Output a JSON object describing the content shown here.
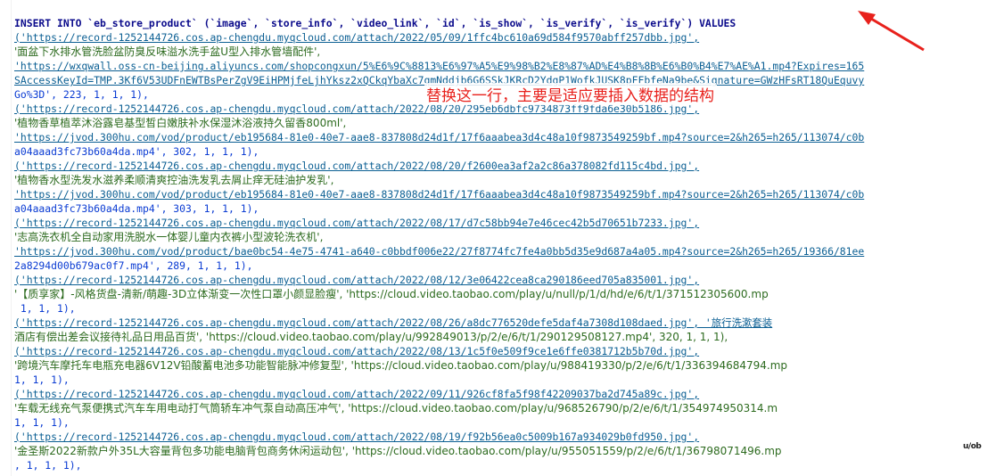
{
  "editor": {
    "lines": [
      {
        "text": "INSERT INTO `eb_store_product` (`image`, `store_info`, `video_link`, `id`, `is_show`, `is_verify`, `is_verify`) VALUES",
        "kind": "kw"
      },
      {
        "text": "('https://record-1252144726.cos.ap-chengdu.myqcloud.com/attach/2022/05/09/1ffc4bc610a69d584f9570abff257dbb.jpg',",
        "kind": "url"
      },
      {
        "text": "'面盆下水排水管洗脸盆防臭反味溢水洗手盆U型入排水管墙配件',",
        "kind": "zh"
      },
      {
        "text": "'https://wxqwall.oss-cn-beijing.aliyuncs.com/shopcongxun/5%E6%9C%8813%E6%97%A5%E9%98%B2%E8%87%AD%E4%B8%8B%E6%B0%B4%E7%AE%A1.mp4?Expires=165",
        "kind": "url"
      },
      {
        "text": "SAccessKeyId=TMP.3Kf6V53UDFnEWTBsPerZgV9EiHPMjfeLjhYksz2xQCkqYbaXc7qmNddjb6G6SSkJKRcD2YdgP1WofkJUSK8pFFbfeNa9be&Signature=GWzHFsRT18QuEquvy",
        "kind": "url"
      },
      {
        "text": "Go%3D', 223, 1, 1, 1),",
        "kind": "mixed"
      },
      {
        "text": "('https://record-1252144726.cos.ap-chengdu.myqcloud.com/attach/2022/08/20/295eb6dbfc9734873ff9fda6e30b5186.jpg',",
        "kind": "url"
      },
      {
        "text": "'植物香草植萃沐浴露皂基型皙白嫩肤补水保湿沐浴液持久留香800ml',",
        "kind": "zh"
      },
      {
        "text": "'https://jvod.300hu.com/vod/product/eb195684-81e0-40e7-aae8-837808d24d1f/17f6aaabea3d4c48a10f9873549259bf.mp4?source=2&h265=h265/113074/c0b",
        "kind": "url"
      },
      {
        "text": "a04aaad3fc73b60a4da.mp4', 302, 1, 1, 1),",
        "kind": "mixed"
      },
      {
        "text": "('https://record-1252144726.cos.ap-chengdu.myqcloud.com/attach/2022/08/20/f2600ea3af2a2c86a378082fd115c4bd.jpg',",
        "kind": "url"
      },
      {
        "text": "'植物香水型洗发水滋养柔顺清爽控油洗发乳去屑止痒无硅油护发乳',",
        "kind": "zh"
      },
      {
        "text": "'https://jvod.300hu.com/vod/product/eb195684-81e0-40e7-aae8-837808d24d1f/17f6aaabea3d4c48a10f9873549259bf.mp4?source=2&h265=h265/113074/c0b",
        "kind": "url"
      },
      {
        "text": "a04aaad3fc73b60a4da.mp4', 303, 1, 1, 1),",
        "kind": "mixed"
      },
      {
        "text": "('https://record-1252144726.cos.ap-chengdu.myqcloud.com/attach/2022/08/17/d7c58bb94e7e46cec42b5d70651b7233.jpg',",
        "kind": "url"
      },
      {
        "text": "'志高洗衣机全自动家用洗脱水一体婴儿童内衣裤小型波轮洗衣机',",
        "kind": "zh"
      },
      {
        "text": "'https://jvod.300hu.com/vod/product/bae0bc54-4e75-4741-a640-c0bbdf006e22/27f8774fc7fe4a0bb5d35e9d687a4a05.mp4?source=2&h265=h265/19366/81ee",
        "kind": "url"
      },
      {
        "text": "2a8294d00b679ac0f7.mp4', 289, 1, 1, 1),",
        "kind": "mixed"
      },
      {
        "text": "('https://record-1252144726.cos.ap-chengdu.myqcloud.com/attach/2022/08/12/3e06422cea8ca290186eed705a835001.jpg',",
        "kind": "url"
      },
      {
        "text": "'【质享家】-风格货盘-清新/萌趣-3D立体渐变一次性口罩小颜显脸瘦', 'https://cloud.video.taobao.com/play/u/null/p/1/d/hd/e/6/t/1/371512305600.mp",
        "kind": "zh"
      },
      {
        "text": " 1, 1, 1),",
        "kind": "mixed"
      },
      {
        "text": "('https://record-1252144726.cos.ap-chengdu.myqcloud.com/attach/2022/08/26/a8dc776520defe5daf4a7308d108daed.jpg', '旅行洗漱套装",
        "kind": "url"
      },
      {
        "text": "酒店有偿出差会议接待礼品日用品百货', 'https://cloud.video.taobao.com/play/u/992849013/p/2/e/6/t/1/290129508127.mp4', 320, 1, 1, 1),",
        "kind": "zh"
      },
      {
        "text": "('https://record-1252144726.cos.ap-chengdu.myqcloud.com/attach/2022/08/13/1c5f0e509f9ce1e6ffe0381712b5b70d.jpg',",
        "kind": "url"
      },
      {
        "text": "'跨境汽车摩托车电瓶充电器6V12V铅酸蓄电池多功能智能脉冲修复型', 'https://cloud.video.taobao.com/play/u/988419330/p/2/e/6/t/1/336394684794.mp",
        "kind": "zh"
      },
      {
        "text": "1, 1, 1),",
        "kind": "mixed"
      },
      {
        "text": "('https://record-1252144726.cos.ap-chengdu.myqcloud.com/attach/2022/09/11/926cf8fa5f98f42209037ba2d745a89c.jpg',",
        "kind": "url"
      },
      {
        "text": "'车载无线充气泵便携式汽车车用电动打气筒轿车冲气泵自动高压冲气', 'https://cloud.video.taobao.com/play/u/968526790/p/2/e/6/t/1/354974950314.m",
        "kind": "zh"
      },
      {
        "text": "1, 1, 1),",
        "kind": "mixed"
      },
      {
        "text": "('https://record-1252144726.cos.ap-chengdu.myqcloud.com/attach/2022/08/19/f92b56ea0c5009b167a934029b0fd950.jpg',",
        "kind": "url"
      },
      {
        "text": "'金圣斯2022新款户外35L大容量背包多功能电脑背包商务休闲运动包', 'https://cloud.video.taobao.com/play/u/955051559/p/2/e/6/t/1/36798071496.mp",
        "kind": "zh"
      },
      {
        "text": ", 1, 1, 1),",
        "kind": "mixed"
      }
    ]
  },
  "annotation": {
    "text": "替换这一行，主要是适应要插入数据的结构",
    "color": "#e8211c"
  },
  "watermark": {
    "text": "u/ob"
  },
  "colors": {
    "keyword": "#0c0c8c",
    "string": "#2d6b1f",
    "url": "#0b5f93",
    "number": "#0b3cd3",
    "annotation": "#e8211c"
  }
}
